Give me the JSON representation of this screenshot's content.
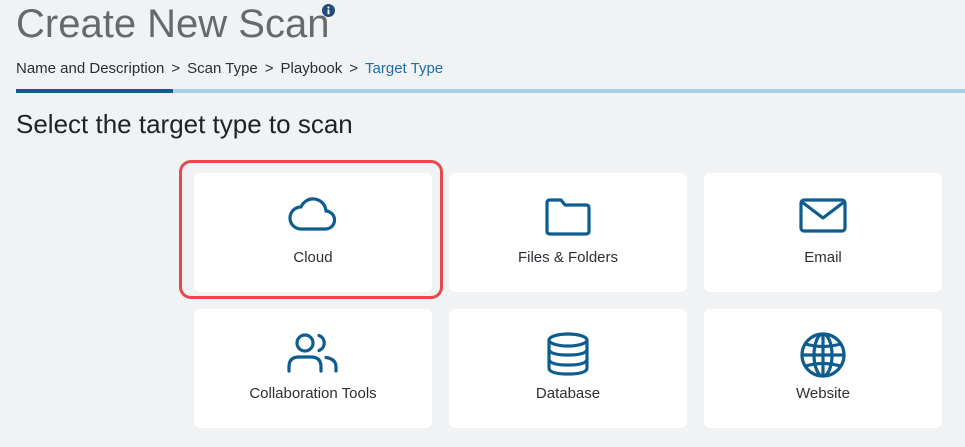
{
  "header": {
    "title": "Create New Scan",
    "info_icon": "info-circle-icon"
  },
  "breadcrumb": {
    "items": [
      "Name and Description",
      "Scan Type",
      "Playbook",
      "Target Type"
    ],
    "separator": ">",
    "active_index": 3
  },
  "progress": {
    "fraction": 0.165
  },
  "main": {
    "heading": "Select the target type to scan",
    "targets": [
      {
        "label": "Cloud",
        "icon": "cloud-icon",
        "selected": true
      },
      {
        "label": "Files & Folders",
        "icon": "folder-icon",
        "selected": false
      },
      {
        "label": "Email",
        "icon": "envelope-icon",
        "selected": false
      },
      {
        "label": "Collaboration Tools",
        "icon": "users-icon",
        "selected": false
      },
      {
        "label": "Database",
        "icon": "database-icon",
        "selected": false
      },
      {
        "label": "Website",
        "icon": "globe-icon",
        "selected": false
      }
    ]
  },
  "colors": {
    "accent": "#1b6fa8",
    "icon": "#0f5c8f",
    "selection": "#e5484d",
    "background": "#f0f2f3"
  }
}
